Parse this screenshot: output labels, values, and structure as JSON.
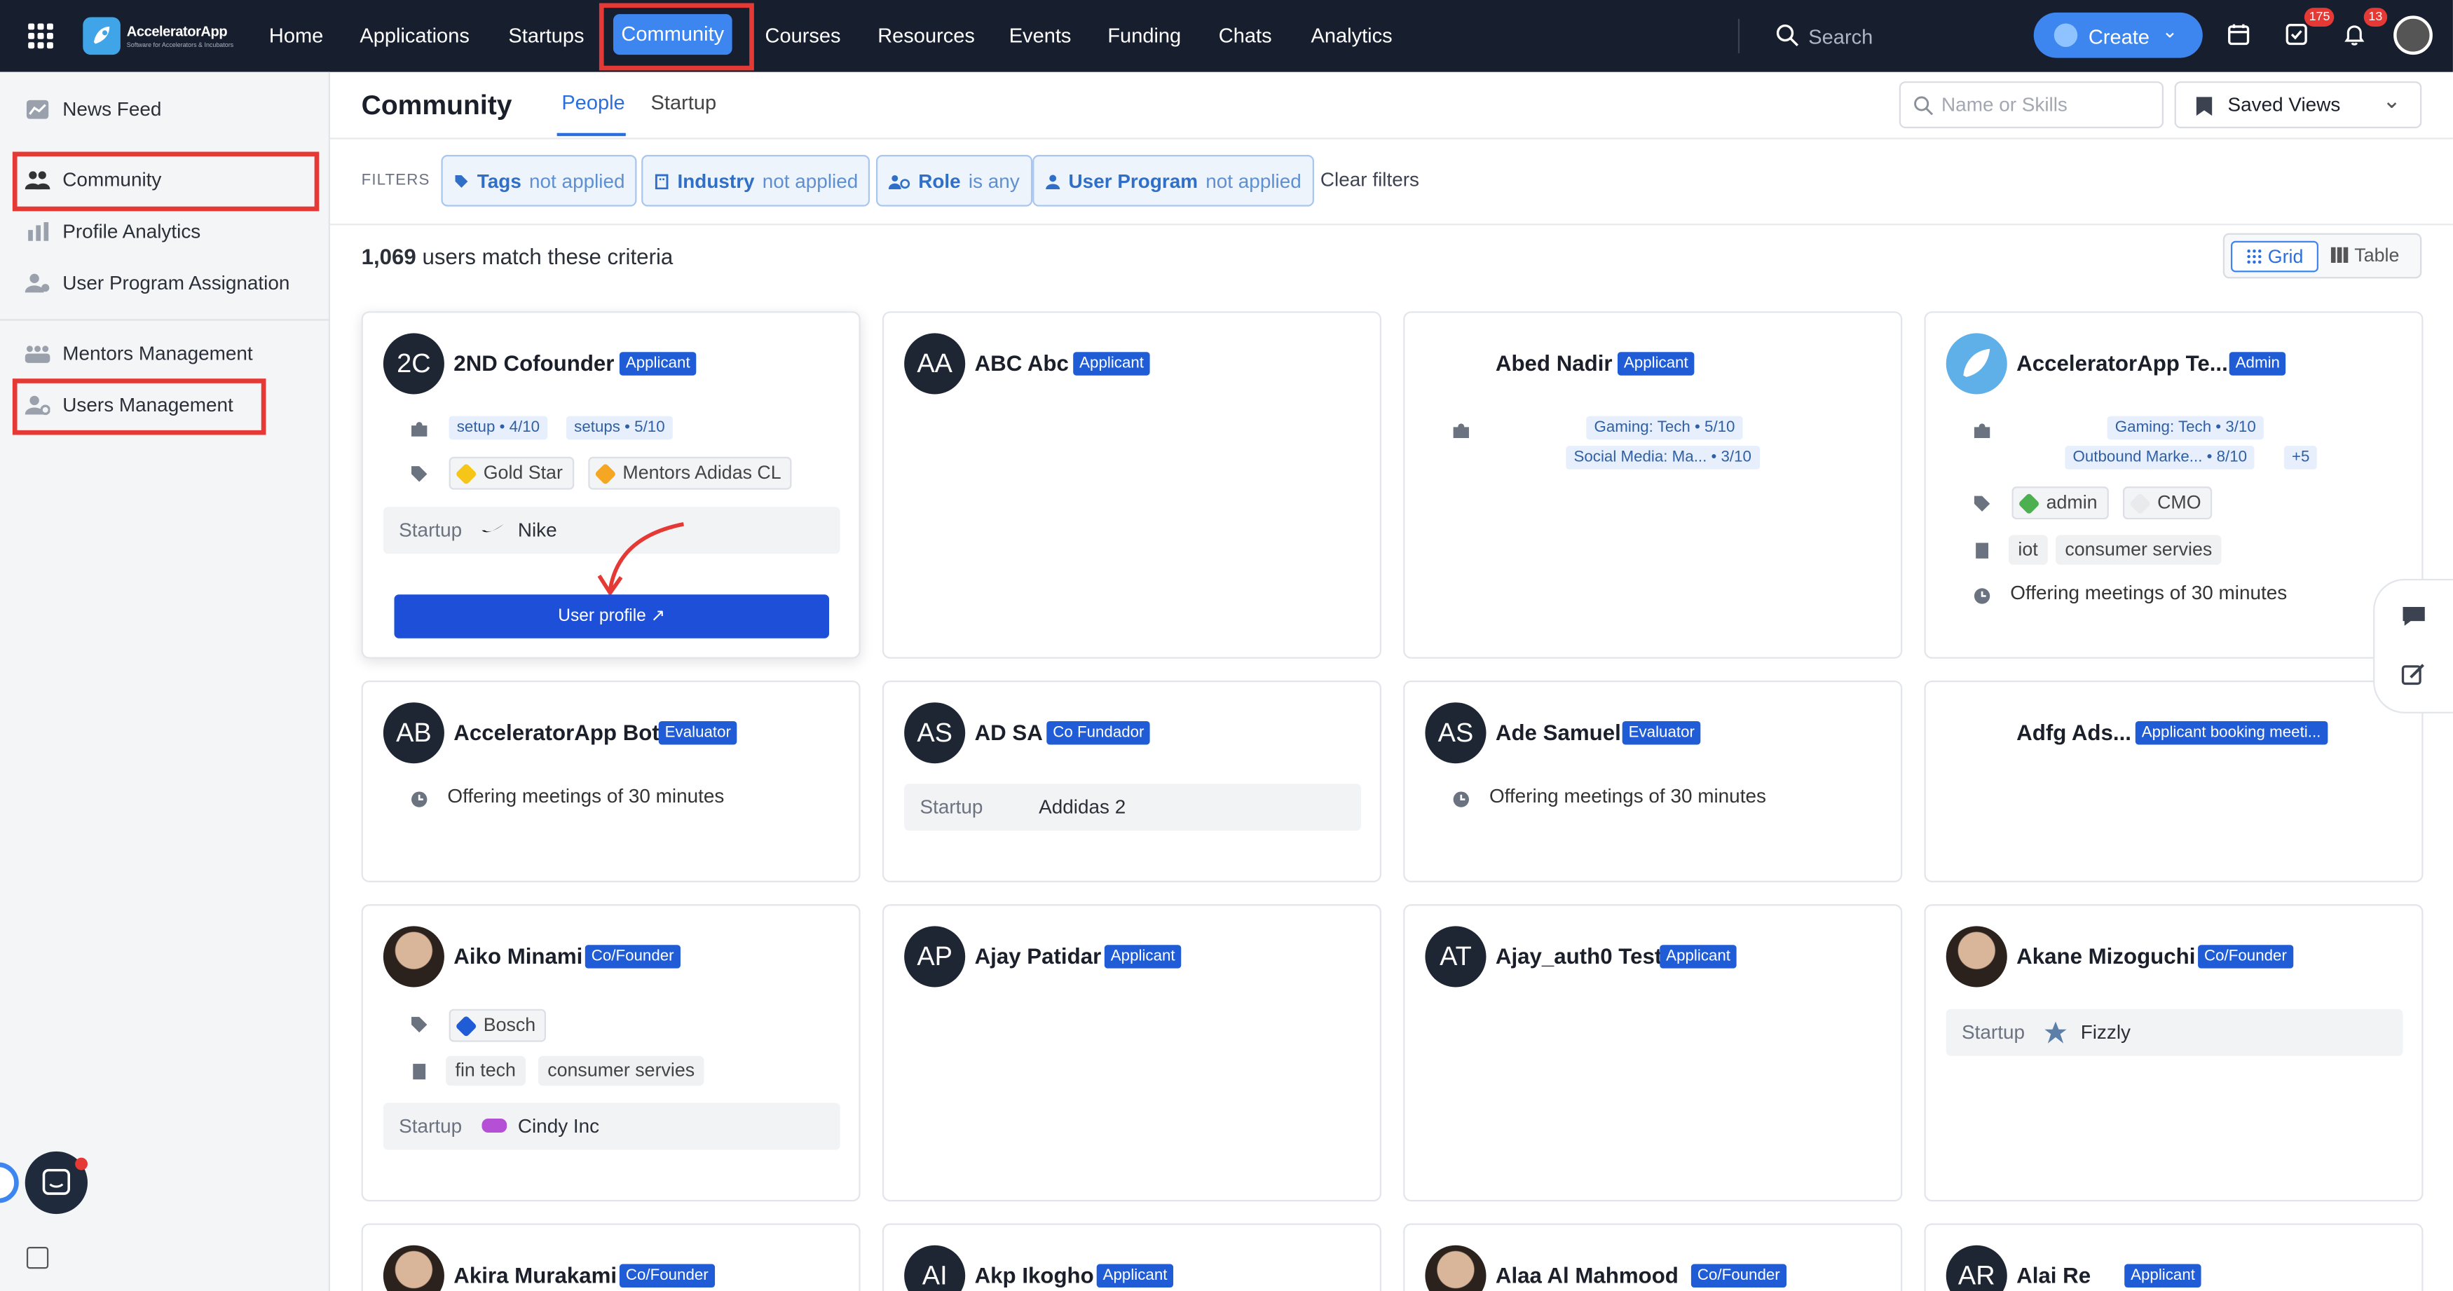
{
  "app": {
    "name": "AcceleratorApp",
    "tagline": "Software for Accelerators & Incubators"
  },
  "topnav": {
    "items": [
      "Home",
      "Applications",
      "Startups",
      "Community",
      "Courses",
      "Resources",
      "Events",
      "Funding",
      "Chats",
      "Analytics"
    ],
    "active": "Community",
    "search_placeholder": "Search",
    "create_label": "Create",
    "tasks_badge": "175",
    "notifications_badge": "13"
  },
  "sidebar": {
    "items": [
      "News Feed",
      "Community",
      "Profile Analytics",
      "User Program Assignation",
      "Mentors Management",
      "Users Management"
    ],
    "active": "Community"
  },
  "header": {
    "title": "Community",
    "tabs": [
      "People",
      "Startup"
    ],
    "active_tab": "People",
    "search_placeholder": "Name or Skills",
    "saved_views_label": "Saved Views"
  },
  "filters": {
    "label": "FILTERS",
    "chips": [
      {
        "name": "Tags",
        "state": "not applied"
      },
      {
        "name": "Industry",
        "state": "not applied"
      },
      {
        "name": "Role",
        "state": "is any"
      },
      {
        "name": "User Program",
        "state": "not applied"
      }
    ],
    "clear_label": "Clear filters"
  },
  "results": {
    "count": "1,069",
    "suffix": "users match these criteria"
  },
  "view_toggle": {
    "grid": "Grid",
    "table": "Table",
    "active": "Grid"
  },
  "cards": [
    {
      "initials": "2C",
      "name": "2ND Cofounder",
      "role": "Applicant",
      "skills": [
        "setup • 4/10",
        "setups • 5/10"
      ],
      "tags": [
        "Gold Star",
        "Mentors Adidas CL"
      ],
      "startup_label": "Startup",
      "startup": "Nike",
      "button": "User profile ↗"
    },
    {
      "initials": "AA",
      "name": "ABC Abc",
      "role": "Applicant"
    },
    {
      "initials": "",
      "name": "Abed Nadir",
      "role": "Applicant",
      "skills": [
        "Gaming: Tech • 5/10",
        "Social Media: Ma... • 3/10"
      ]
    },
    {
      "initials": "",
      "name": "AcceleratorApp Te...",
      "role": "Admin",
      "skills": [
        "Gaming: Tech • 3/10",
        "Outbound Marke... • 8/10",
        "+5"
      ],
      "tags": [
        "admin",
        "CMO"
      ],
      "industries": [
        "iot",
        "consumer servies"
      ],
      "meetings": "Offering meetings of 30 minutes"
    },
    {
      "initials": "AB",
      "name": "AcceleratorApp Bot",
      "role": "Evaluator",
      "meetings": "Offering meetings of 30 minutes"
    },
    {
      "initials": "AS",
      "name": "AD SA",
      "role": "Co Fundador",
      "startup_label": "Startup",
      "startup": "Addidas 2"
    },
    {
      "initials": "AS",
      "name": "Ade Samuel",
      "role": "Evaluator",
      "meetings": "Offering meetings of 30 minutes"
    },
    {
      "initials": "",
      "name": "Adfg Ads...",
      "role": "Applicant booking meeti..."
    },
    {
      "initials": "",
      "name": "Aiko Minami",
      "role": "Co/Founder",
      "tags": [
        "Bosch"
      ],
      "industries": [
        "fin tech",
        "consumer servies"
      ],
      "startup_label": "Startup",
      "startup": "Cindy Inc"
    },
    {
      "initials": "AP",
      "name": "Ajay Patidar",
      "role": "Applicant"
    },
    {
      "initials": "AT",
      "name": "Ajay_auth0 Test",
      "role": "Applicant"
    },
    {
      "initials": "",
      "name": "Akane Mizoguchi",
      "role": "Co/Founder",
      "startup_label": "Startup",
      "startup": "Fizzly"
    },
    {
      "initials": "",
      "name": "Akira Murakami",
      "role": "Co/Founder"
    },
    {
      "initials": "AI",
      "name": "Akp Ikogho",
      "role": "Applicant"
    },
    {
      "initials": "",
      "name": "Alaa Al Mahmood",
      "role": "Co/Founder"
    },
    {
      "initials": "AR",
      "name": "Alai Re",
      "role": "Applicant"
    }
  ],
  "colors": {
    "nav_bg": "#171e2e",
    "accent": "#3d86f0",
    "role_badge": "#1f5cd6",
    "highlight": "#e53935",
    "profile_button": "#1d4fd8"
  },
  "icons": [
    "apps-grid-icon",
    "search-icon",
    "rocket-icon",
    "calendar-icon",
    "tasks-icon",
    "bell-icon",
    "puzzle-icon",
    "tag-icon",
    "building-icon",
    "clock-icon",
    "comment-icon",
    "edit-icon",
    "collapse-icon"
  ]
}
